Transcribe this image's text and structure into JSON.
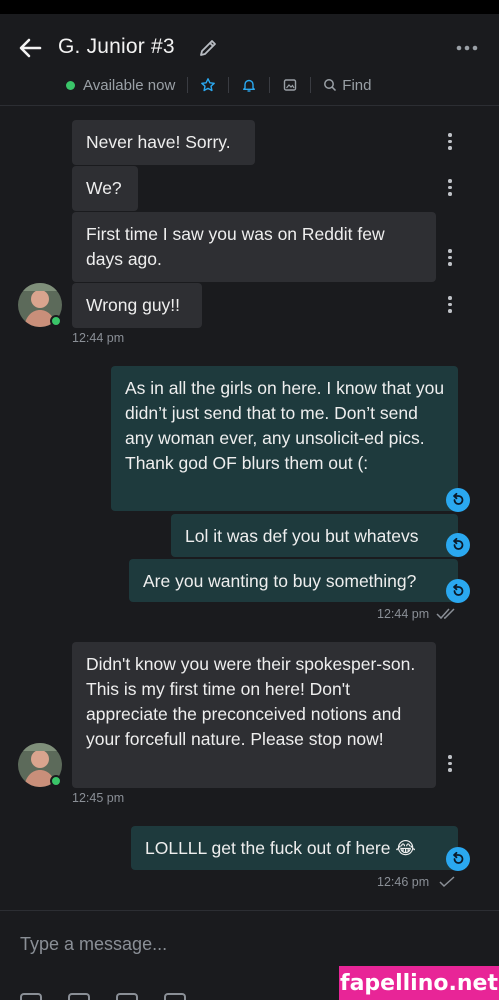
{
  "header": {
    "title": "G. Junior #3",
    "status": "Available now",
    "find_label": "Find"
  },
  "messages": [
    {
      "side": "in",
      "text": "Never have! Sorry."
    },
    {
      "side": "in",
      "text": "We?"
    },
    {
      "side": "in",
      "text": "First time I saw you was on Reddit few days ago."
    },
    {
      "side": "in",
      "text": "Wrong guy!!"
    },
    {
      "side": "out",
      "text": "As in all the girls on here. I know that you didn’t just send that to me. Don’t send any woman ever, any unsolicit-ed pics. Thank god OF blurs them out (:"
    },
    {
      "side": "out",
      "text": "Lol it was def you but whatevs"
    },
    {
      "side": "out",
      "text": "Are you wanting to buy something?"
    },
    {
      "side": "in",
      "text": "Didn't know you were their spokesper-son. This is my first time on here! Don't appreciate the preconceived notions and your forcefull nature. Please stop now!"
    },
    {
      "side": "out",
      "text": "LOLLLL get the fuck out of here 😂"
    }
  ],
  "timestamps": {
    "t1": "12:44 pm",
    "t2": "12:44 pm",
    "t3": "12:45 pm",
    "t4": "12:46 pm"
  },
  "composer": {
    "placeholder": "Type a message..."
  },
  "watermark": "fapellino.net",
  "colors": {
    "background": "#1a1b1e",
    "incoming_bubble": "#2e2f33",
    "outgoing_bubble": "#1e3a3d",
    "online": "#3ac569",
    "accent": "#2aa8f0",
    "watermark": "#e82597"
  }
}
